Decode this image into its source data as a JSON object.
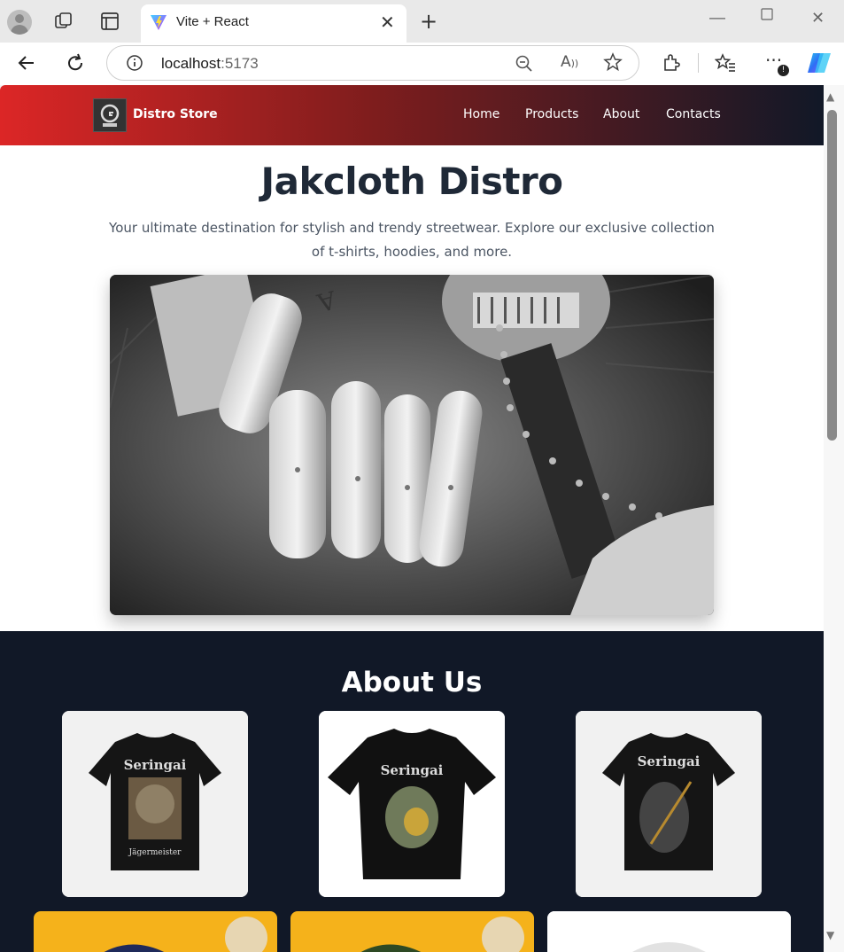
{
  "browser": {
    "tab_title": "Vite + React",
    "url_host": "localhost",
    "url_port": ":5173"
  },
  "site": {
    "brand": "Distro Store",
    "nav": [
      "Home",
      "Products",
      "About",
      "Contacts"
    ]
  },
  "hero": {
    "title": "Jakcloth Distro",
    "subtitle": "Your ultimate destination for stylish and trendy streetwear. Explore our exclusive collection of t-shirts, hoodies, and more."
  },
  "about": {
    "title": "About Us"
  },
  "colors": {
    "nav_start": "#dc2626",
    "nav_end": "#111827",
    "about_bg": "#111827",
    "title_text": "#1f2937"
  },
  "products_shown": [
    {
      "label": "Seringai"
    },
    {
      "label": "Seringai"
    },
    {
      "label": "Seringai"
    }
  ],
  "product_logo_sub": "Jägermeister"
}
